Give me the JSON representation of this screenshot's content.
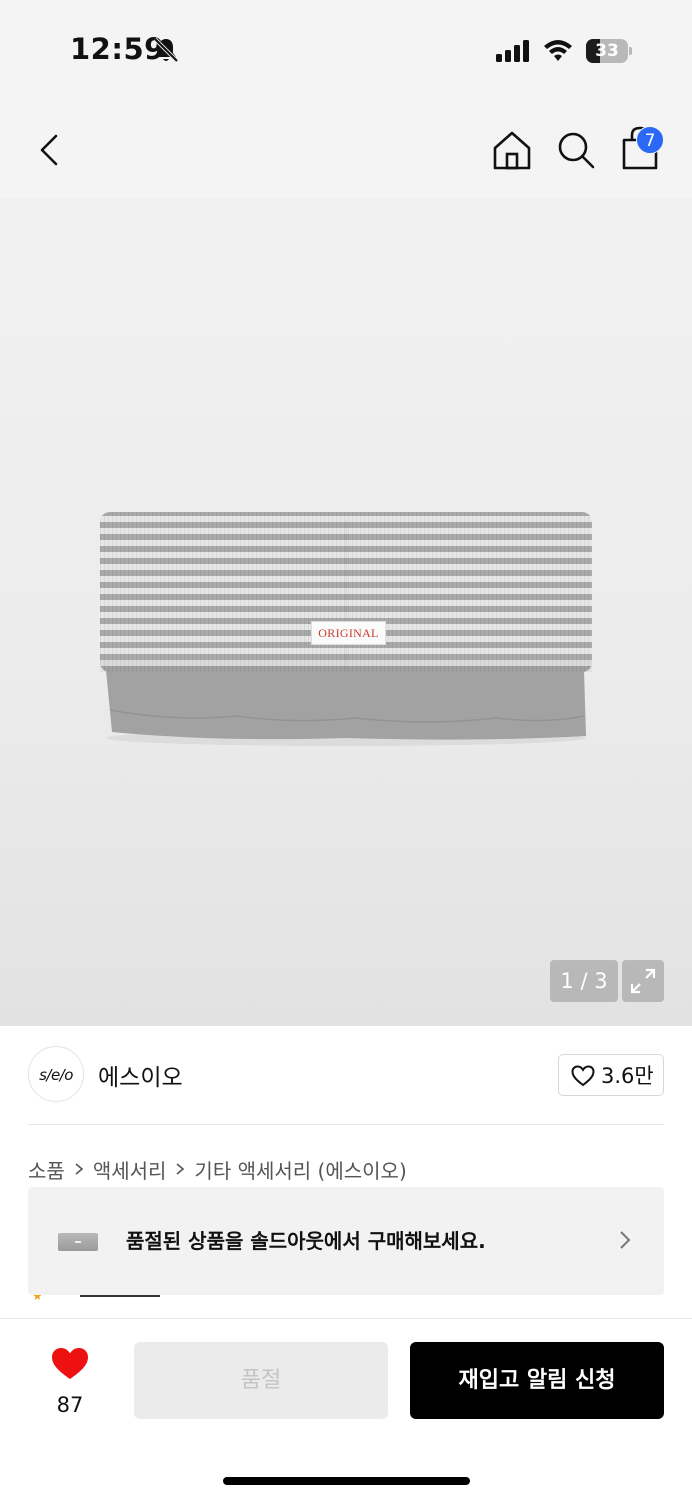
{
  "status_bar": {
    "time": "12:59",
    "battery_level": "33",
    "icons": [
      "bell-slash-icon",
      "signal-icon",
      "wifi-icon",
      "battery-icon"
    ]
  },
  "nav": {
    "cart_count": "7",
    "icons": [
      "back-icon",
      "home-icon",
      "search-icon",
      "shopping-bag-icon"
    ]
  },
  "product_image": {
    "label_text": "ORIGINAL",
    "counter": "1 / 3",
    "expand_icon": "expand-icon"
  },
  "brand": {
    "logo_text": "s/e/o",
    "name": "에스이오",
    "likes": "3.6만"
  },
  "breadcrumb": [
    "소품",
    "액세서리",
    "기타 액세서리 (에스이오)"
  ],
  "banner": {
    "text": "품절된 상품을 솔드아웃에서 구매해보세요."
  },
  "bottom_bar": {
    "wish_count": "87",
    "soldout_label": "품절",
    "restock_label": "재입고 알림 신청"
  },
  "colors": {
    "accent_blue": "#2b68f6",
    "wish_red": "#ee1111",
    "label_red": "#c83a32"
  }
}
